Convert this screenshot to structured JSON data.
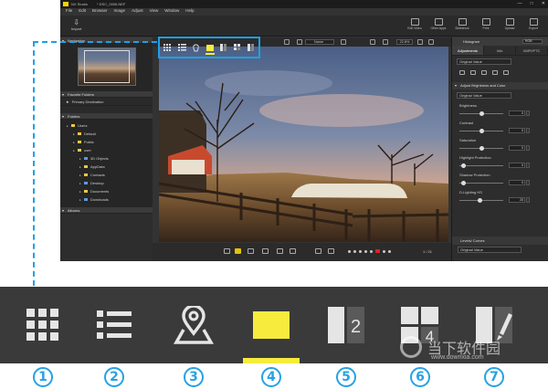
{
  "window": {
    "app_title": "NX Studio",
    "doc_title": "* DSC_0006.NEF",
    "controls": [
      "—",
      "□",
      "✕"
    ]
  },
  "menu": [
    "File",
    "Edit",
    "Browser",
    "Image",
    "Adjust",
    "View",
    "Window",
    "Help"
  ],
  "toolbar": {
    "import_label": "Import",
    "right_tools": [
      "Edit Video",
      "Other Apps",
      "Slideshow",
      "Print",
      "Upload",
      "Export"
    ]
  },
  "left_panel": {
    "navigator_header": "Navigation",
    "favorites_header": "Favorite Folders",
    "favorites": [
      "Primary Destination"
    ],
    "folders_header": "Folders",
    "tree": [
      {
        "label": "Users",
        "indent": 1,
        "color": "yellow"
      },
      {
        "label": "Default",
        "indent": 2,
        "color": "yellow"
      },
      {
        "label": "Public",
        "indent": 2,
        "color": "yellow"
      },
      {
        "label": "user",
        "indent": 2,
        "color": "yellow"
      },
      {
        "label": "3D Objects",
        "indent": 3,
        "color": "blue"
      },
      {
        "label": "AppData",
        "indent": 3,
        "color": "yellow"
      },
      {
        "label": "Contacts",
        "indent": 3,
        "color": "yellow"
      },
      {
        "label": "Desktop",
        "indent": 3,
        "color": "blue"
      },
      {
        "label": "Documents",
        "indent": 3,
        "color": "yellow"
      },
      {
        "label": "Downloads",
        "indent": 3,
        "color": "blue"
      }
    ],
    "albums_header": "Albums"
  },
  "center": {
    "sort_label": "Name",
    "zoom_label": "22.8%",
    "counter": "1 / 21"
  },
  "right_panel": {
    "histogram_header": "Histogram",
    "histogram_channel": "RGB",
    "tabs": [
      "Adjustments",
      "Info",
      "XMP/IPTC"
    ],
    "preset": "Original Value",
    "section": "Adjust Brightness and Color",
    "section_preset": "Original Value",
    "sliders": [
      {
        "label": "Brightness",
        "value": "0"
      },
      {
        "label": "Contrast",
        "value": "0"
      },
      {
        "label": "Saturation",
        "value": "0"
      },
      {
        "label": "Highlight Protection",
        "value": "0"
      },
      {
        "label": "Shadow Protection",
        "value": "0"
      },
      {
        "label": "D-Lighting HS",
        "value": "25"
      }
    ],
    "levels_header": "Levels/ Curves",
    "levels_preset": "Original Value"
  },
  "view_modes": [
    {
      "icon": "thumbnail-grid-icon"
    },
    {
      "icon": "thumbnail-list-icon"
    },
    {
      "icon": "map-icon"
    },
    {
      "icon": "image-viewer-icon",
      "active": true
    },
    {
      "icon": "two-image-compare-icon",
      "number": "2"
    },
    {
      "icon": "four-image-compare-icon",
      "number": "4"
    },
    {
      "icon": "before-after-compare-icon"
    }
  ],
  "view_numbers": [
    "①",
    "②",
    "③",
    "④",
    "⑤",
    "⑥",
    "⑦"
  ],
  "colors": {
    "accent_blue": "#1ea1e6",
    "active_yellow": "#f7eb3d",
    "app_bg": "#333333",
    "zoom_bar_bg": "#3a3a3a"
  },
  "watermark": {
    "text_cn": "当下软件园",
    "url": "www.downxia.com"
  }
}
